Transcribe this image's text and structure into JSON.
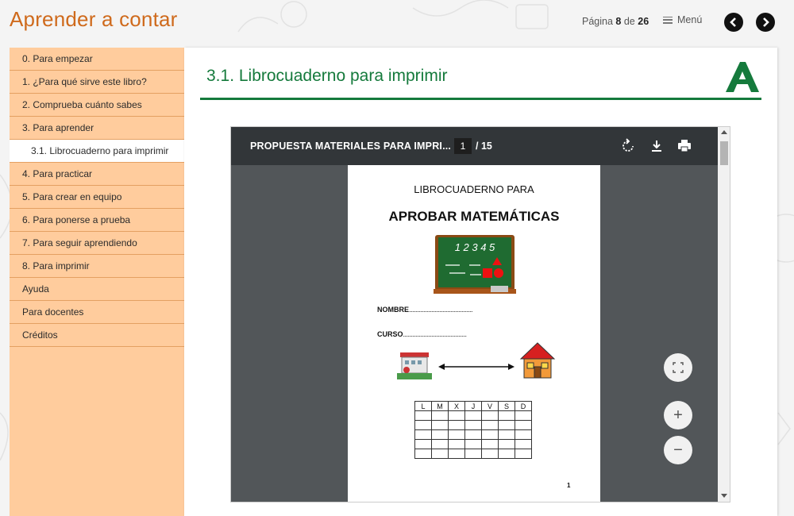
{
  "header": {
    "app_title": "Aprender a contar",
    "page_label": "Página",
    "page_current": "8",
    "page_of": "de",
    "page_total": "26",
    "menu_label": "Menú"
  },
  "sidebar": {
    "items": [
      {
        "label": "0. Para empezar"
      },
      {
        "label": "1. ¿Para qué sirve este libro?"
      },
      {
        "label": "2. Comprueba cuánto sabes"
      },
      {
        "label": "3. Para aprender"
      },
      {
        "label": "3.1. Librocuaderno para imprimir",
        "active": true
      },
      {
        "label": "4. Para practicar"
      },
      {
        "label": "5. Para crear en equipo"
      },
      {
        "label": "6. Para ponerse a prueba"
      },
      {
        "label": "7. Para seguir aprendiendo"
      },
      {
        "label": "8. Para imprimir"
      },
      {
        "label": "Ayuda"
      },
      {
        "label": "Para docentes"
      },
      {
        "label": "Créditos"
      }
    ]
  },
  "main": {
    "section_title": "3.1. Librocuaderno para imprimir"
  },
  "pdf": {
    "document_name": "PROPUESTA MATERIALES PARA IMPRI...",
    "current_page": "1",
    "total_pages": "/ 15",
    "page": {
      "subtitle": "LIBROCUADERNO PARA",
      "title": "APROBAR MATEMÁTICAS",
      "chalk_numbers": "1 2 3 4 5",
      "name_label": "NOMBRE",
      "course_label": "CURSO",
      "dots": "........................................",
      "week_days": [
        "L",
        "M",
        "X",
        "J",
        "V",
        "S",
        "D"
      ],
      "page_number": "1"
    },
    "controls": {
      "fit_symbol": "⛶",
      "zoom_in_symbol": "+",
      "zoom_out_symbol": "−"
    }
  },
  "colors": {
    "title_orange": "#cf6a1c",
    "sidebar_bg": "#ffcc9d",
    "section_green": "#157a3c",
    "pdf_toolbar": "#323639",
    "pdf_bg": "#525659"
  },
  "icons": {
    "rotate": "rotate-icon",
    "download": "download-icon",
    "print": "print-icon",
    "prev": "chevron-left-icon",
    "next": "chevron-right-icon",
    "menu": "hamburger-icon",
    "logo": "junta-andalucia-logo"
  }
}
